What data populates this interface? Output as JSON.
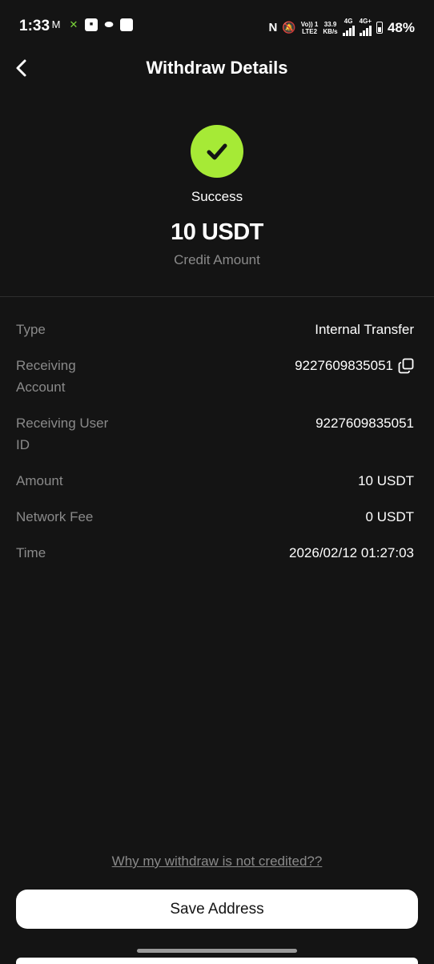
{
  "status_bar": {
    "time": "1:33",
    "volte_line1": "Vo)) 1",
    "volte_line2": "LTE2",
    "speed_line1": "33.9",
    "speed_line2": "KB/s",
    "net1": "4G",
    "net2": "4G+",
    "battery": "48%"
  },
  "header": {
    "title": "Withdraw Details"
  },
  "hero": {
    "status": "Success",
    "amount": "10 USDT",
    "amount_label": "Credit Amount",
    "accent_color": "#a6ea36"
  },
  "details": {
    "type_label": "Type",
    "type_value": "Internal Transfer",
    "account_label": "Receiving Account",
    "account_value": "9227609835051",
    "user_id_label": "Receiving User ID",
    "user_id_value": "9227609835051",
    "amount_label": "Amount",
    "amount_value": "10 USDT",
    "fee_label": "Network Fee",
    "fee_value": "0 USDT",
    "time_label": "Time",
    "time_value": "2026/02/12 01:27:03"
  },
  "footer": {
    "help_link": "Why my withdraw is not credited??",
    "save_button": "Save Address"
  }
}
